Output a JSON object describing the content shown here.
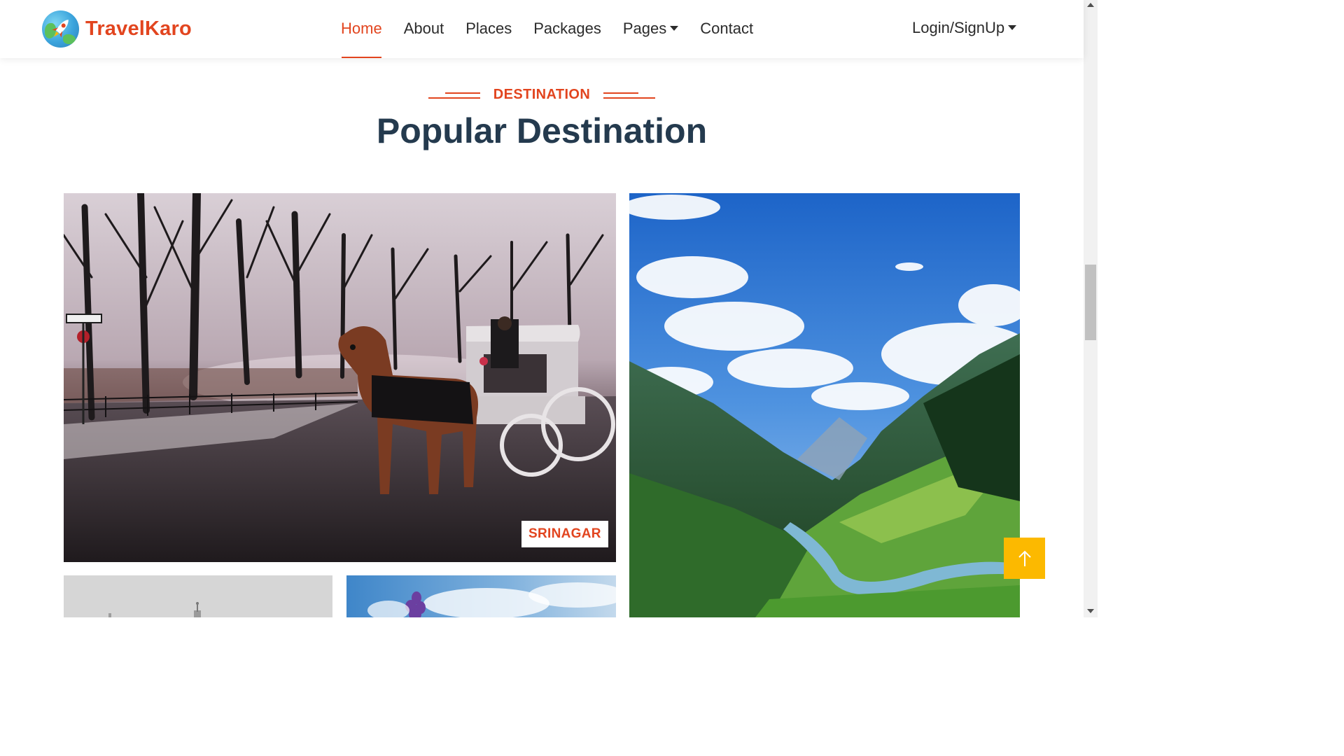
{
  "brand": {
    "name": "TravelKaro",
    "logo_icon": "rocket-globe-icon"
  },
  "nav": {
    "items": [
      {
        "label": "Home",
        "active": true
      },
      {
        "label": "About"
      },
      {
        "label": "Places"
      },
      {
        "label": "Packages"
      },
      {
        "label": "Pages",
        "dropdown": true
      },
      {
        "label": "Contact"
      }
    ],
    "login_label": "Login/SignUp"
  },
  "section": {
    "eyebrow": "DESTINATION",
    "title": "Popular Destination"
  },
  "destinations": [
    {
      "label": "SRINAGAR",
      "image": "horse-carriage-winter-street"
    },
    {
      "label": "",
      "image": "green-mountain-valley"
    },
    {
      "label": "",
      "image": "misty-mosque-dome"
    },
    {
      "label": "",
      "image": "purple-flower-blue-sky"
    }
  ],
  "back_to_top": {
    "icon": "arrow-up-icon"
  },
  "colors": {
    "accent": "#e2451f",
    "title": "#243a4e",
    "back_to_top": "#fcb900"
  }
}
